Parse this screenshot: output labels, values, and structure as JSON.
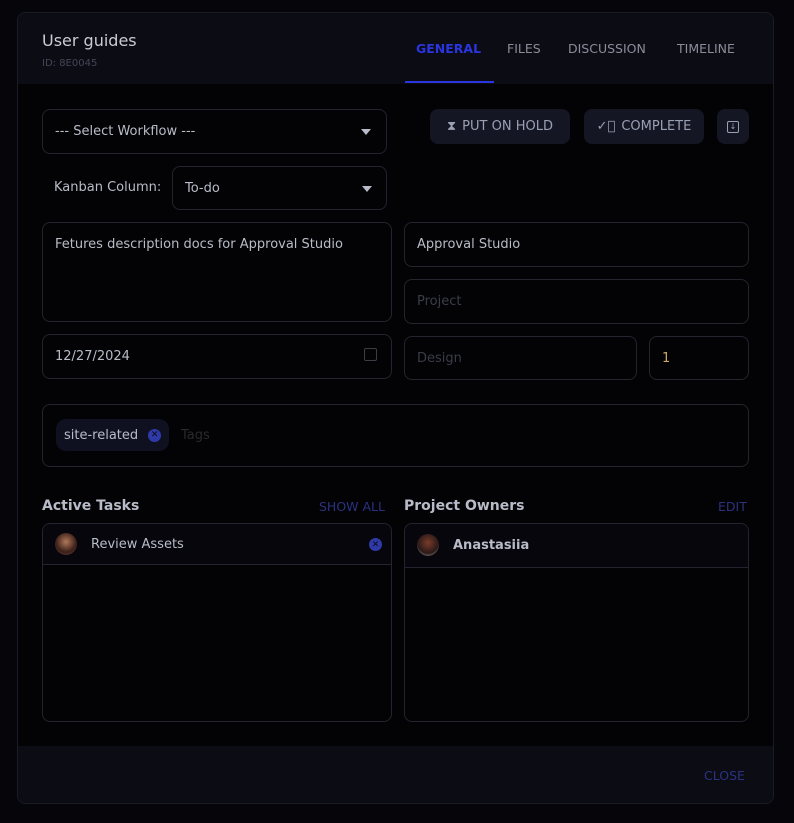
{
  "header": {
    "title": "User guides",
    "id": "ID: 8E0045"
  },
  "tabs": [
    {
      "label": "GENERAL"
    },
    {
      "label": "FILES"
    },
    {
      "label": "DISCUSSION"
    },
    {
      "label": "TIMELINE"
    }
  ],
  "workflow": {
    "value": "--- Select Workflow ---"
  },
  "actions": {
    "hold": "PUT ON HOLD",
    "complete": "COMPLETE"
  },
  "kanban": {
    "label": "Kanban Column:",
    "value": "To-do"
  },
  "form": {
    "description": "Fetures description docs for Approval Studio",
    "client": "Approval Studio",
    "project_placeholder": "Project",
    "date": "12/27/2024",
    "type_placeholder": "Design",
    "quantity": "1",
    "tags_placeholder": "Tags"
  },
  "tags": [
    "site-related"
  ],
  "tasks": {
    "title": "Active Tasks",
    "show_all": "SHOW ALL",
    "items": [
      {
        "name": "Review Assets"
      }
    ]
  },
  "owners": {
    "title": "Project Owners",
    "edit": "EDIT",
    "items": [
      {
        "name": "Anastasiia"
      }
    ]
  },
  "footer": {
    "close": "CLOSE"
  }
}
